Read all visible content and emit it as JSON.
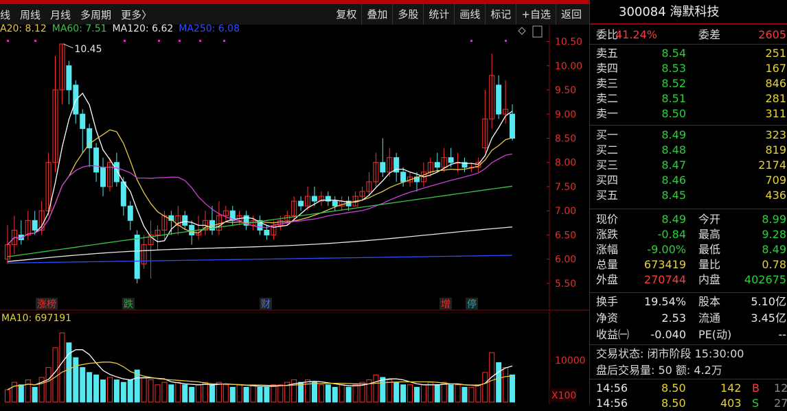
{
  "toolbar": {
    "left": [
      "线",
      "周线",
      "月线",
      "多周期",
      "更多〉"
    ],
    "right": [
      "复权",
      "叠加",
      "多股",
      "统计",
      "画线",
      "标记",
      "+自选",
      "返回"
    ]
  },
  "ma_legend": [
    {
      "label": "A20: 8.12",
      "color": "#e6c84a"
    },
    {
      "label": "MA60: 7.51",
      "color": "#37c74a"
    },
    {
      "label": "MA120: 6.62",
      "color": "#e8e8e8"
    },
    {
      "label": "MA250: 6.08",
      "color": "#2f4bff"
    }
  ],
  "chart_data": {
    "type": "candlestick",
    "y_ticks": [
      "10.50",
      "10.00",
      "9.50",
      "9.00",
      "8.50",
      "8.00",
      "7.50",
      "7.00",
      "6.50",
      "6.00",
      "5.50"
    ],
    "ylim": [
      5.4,
      10.55
    ],
    "high_marker": "10.45",
    "events": [
      {
        "label": "涨榜",
        "color": "#e03030"
      },
      {
        "label": "跌",
        "color": "#23b23a"
      },
      {
        "label": "财",
        "color": "#3a78ff"
      },
      {
        "label": "增",
        "color": "#e03030"
      },
      {
        "label": "停",
        "color": "#2aa3b0"
      }
    ],
    "volume_legend": "MA10: 697191",
    "volume_tick": "10000",
    "volume_unit": "X100",
    "candles": [
      [
        6.0,
        6.3,
        6.7,
        5.9
      ],
      [
        6.3,
        6.6,
        6.9,
        6.1
      ],
      [
        6.5,
        6.4,
        6.8,
        6.3
      ],
      [
        6.5,
        6.8,
        7.0,
        6.4
      ],
      [
        6.8,
        6.6,
        7.0,
        6.5
      ],
      [
        6.6,
        7.0,
        7.2,
        6.5
      ],
      [
        7.0,
        8.0,
        8.2,
        6.9
      ],
      [
        8.0,
        9.5,
        10.2,
        7.8
      ],
      [
        9.5,
        10.45,
        10.45,
        9.2
      ],
      [
        10.0,
        9.5,
        10.1,
        9.2
      ],
      [
        9.6,
        9.0,
        9.7,
        8.8
      ],
      [
        9.0,
        8.7,
        9.1,
        8.2
      ],
      [
        8.7,
        8.3,
        8.8,
        7.9
      ],
      [
        8.3,
        7.8,
        8.4,
        7.6
      ],
      [
        7.9,
        7.5,
        8.1,
        7.3
      ],
      [
        7.5,
        8.0,
        8.1,
        7.4
      ],
      [
        8.0,
        7.6,
        8.2,
        7.5
      ],
      [
        7.6,
        7.1,
        7.7,
        6.9
      ],
      [
        7.1,
        6.8,
        7.2,
        6.6
      ],
      [
        6.5,
        5.6,
        6.6,
        5.5
      ],
      [
        5.9,
        6.3,
        6.5,
        5.8
      ],
      [
        6.3,
        6.5,
        6.8,
        5.6
      ],
      [
        6.5,
        6.6,
        6.7,
        6.2
      ],
      [
        6.6,
        6.9,
        7.0,
        6.4
      ],
      [
        6.9,
        6.8,
        7.0,
        6.5
      ],
      [
        6.7,
        6.9,
        7.1,
        6.5
      ],
      [
        6.9,
        6.7,
        7.0,
        6.6
      ],
      [
        6.7,
        6.5,
        6.8,
        6.3
      ],
      [
        6.5,
        6.6,
        6.9,
        6.4
      ],
      [
        6.6,
        6.8,
        7.0,
        6.5
      ],
      [
        6.8,
        6.6,
        7.1,
        6.5
      ],
      [
        6.6,
        6.9,
        7.2,
        6.5
      ],
      [
        6.9,
        7.0,
        7.1,
        6.8
      ],
      [
        7.0,
        6.8,
        7.1,
        6.7
      ],
      [
        6.8,
        6.9,
        7.0,
        6.7
      ],
      [
        6.9,
        6.7,
        7.0,
        6.6
      ],
      [
        6.7,
        6.8,
        6.9,
        6.6
      ],
      [
        6.8,
        6.6,
        6.9,
        6.5
      ],
      [
        6.6,
        6.5,
        6.7,
        6.4
      ],
      [
        6.5,
        6.7,
        6.8,
        6.4
      ],
      [
        6.7,
        6.8,
        6.9,
        6.6
      ],
      [
        6.8,
        6.9,
        7.0,
        6.7
      ],
      [
        6.9,
        7.2,
        7.3,
        6.8
      ],
      [
        7.2,
        7.1,
        7.3,
        7.0
      ],
      [
        7.1,
        7.3,
        7.5,
        7.0
      ],
      [
        7.3,
        7.2,
        7.5,
        7.1
      ],
      [
        7.2,
        7.3,
        7.4,
        7.1
      ],
      [
        7.3,
        7.2,
        7.4,
        7.1
      ],
      [
        7.2,
        7.1,
        7.3,
        7.0
      ],
      [
        7.1,
        7.2,
        7.3,
        7.0
      ],
      [
        7.2,
        7.1,
        7.3,
        7.0
      ],
      [
        7.1,
        7.3,
        7.4,
        7.1
      ],
      [
        7.3,
        7.4,
        7.5,
        7.2
      ],
      [
        7.4,
        7.6,
        7.8,
        7.3
      ],
      [
        7.6,
        8.0,
        8.2,
        7.5
      ],
      [
        8.0,
        7.8,
        8.5,
        7.7
      ],
      [
        7.8,
        8.1,
        8.3,
        7.7
      ],
      [
        8.1,
        7.8,
        8.2,
        7.6
      ],
      [
        7.8,
        7.6,
        7.9,
        7.5
      ],
      [
        7.6,
        7.7,
        7.8,
        7.5
      ],
      [
        7.7,
        7.6,
        7.8,
        7.4
      ],
      [
        7.6,
        7.8,
        8.0,
        7.5
      ],
      [
        7.8,
        8.0,
        8.1,
        7.7
      ],
      [
        8.0,
        7.9,
        8.2,
        7.8
      ],
      [
        7.9,
        8.1,
        8.3,
        7.8
      ],
      [
        8.1,
        8.0,
        8.3,
        7.9
      ],
      [
        8.0,
        8.0,
        8.2,
        7.8
      ],
      [
        8.0,
        7.9,
        8.1,
        7.8
      ],
      [
        7.9,
        7.9,
        8.0,
        7.8
      ],
      [
        7.9,
        8.0,
        8.1,
        7.8
      ],
      [
        8.3,
        8.9,
        9.5,
        8.2
      ],
      [
        8.9,
        9.8,
        10.25,
        8.7
      ],
      [
        9.6,
        9.0,
        9.8,
        8.9
      ],
      [
        9.0,
        9.1,
        9.7,
        8.8
      ],
      [
        9.0,
        8.5,
        9.2,
        8.45
      ]
    ],
    "volumes": [
      5,
      8,
      7,
      9,
      6,
      10,
      14,
      22,
      28,
      24,
      18,
      14,
      12,
      11,
      9,
      10,
      9,
      8,
      9,
      13,
      10,
      9,
      7,
      8,
      7,
      8,
      7,
      6,
      7,
      8,
      7,
      8,
      7,
      6,
      7,
      6,
      7,
      6,
      6,
      7,
      7,
      8,
      9,
      8,
      9,
      8,
      7,
      7,
      6,
      7,
      6,
      7,
      8,
      9,
      11,
      10,
      9,
      8,
      7,
      7,
      6,
      7,
      8,
      7,
      8,
      7,
      7,
      6,
      6,
      7,
      12,
      20,
      16,
      14,
      11
    ]
  },
  "stock": {
    "title": "300084 海默科技",
    "weibi_label": "委比",
    "weibi": "41.24%",
    "weicha_label": "委差",
    "weicha": "2605",
    "asks": [
      {
        "label": "卖五",
        "price": "8.54",
        "vol": "251"
      },
      {
        "label": "卖四",
        "price": "8.53",
        "vol": "167"
      },
      {
        "label": "卖三",
        "price": "8.52",
        "vol": "846"
      },
      {
        "label": "卖二",
        "price": "8.51",
        "vol": "281"
      },
      {
        "label": "卖一",
        "price": "8.50",
        "vol": "311"
      }
    ],
    "bids": [
      {
        "label": "买一",
        "price": "8.49",
        "vol": "323"
      },
      {
        "label": "买二",
        "price": "8.48",
        "vol": "819"
      },
      {
        "label": "买三",
        "price": "8.47",
        "vol": "2174"
      },
      {
        "label": "买四",
        "price": "8.46",
        "vol": "709"
      },
      {
        "label": "买五",
        "price": "8.45",
        "vol": "436"
      }
    ],
    "stats": [
      {
        "l1": "现价",
        "v1": "8.49",
        "c1": "green",
        "l2": "今开",
        "v2": "8.99",
        "c2": "green"
      },
      {
        "l1": "涨跌",
        "v1": "-0.84",
        "c1": "green",
        "l2": "最高",
        "v2": "9.28",
        "c2": "green"
      },
      {
        "l1": "涨幅",
        "v1": "-9.00%",
        "c1": "green",
        "l2": "最低",
        "v2": "8.49",
        "c2": "green"
      },
      {
        "l1": "总量",
        "v1": "673419",
        "c1": "yel",
        "l2": "量比",
        "v2": "0.78",
        "c2": "yel"
      },
      {
        "l1": "外盘",
        "v1": "270744",
        "c1": "red",
        "l2": "内盘",
        "v2": "402675",
        "c2": "green"
      }
    ],
    "stats2": [
      {
        "l1": "换手",
        "v1": "19.54%",
        "l2": "股本",
        "v2": "5.10亿"
      },
      {
        "l1": "净资",
        "v1": "2.53",
        "l2": "流通",
        "v2": "3.45亿"
      },
      {
        "l1": "收益㈠",
        "v1": "-0.040",
        "l2": "PE(动)",
        "v2": "--"
      }
    ],
    "trade_status": "交易状态: 闭市阶段 15:30:00",
    "after_hours": "盘后交易量: 50  额: 4.2万",
    "ticks": [
      {
        "time": "14:56",
        "price": "8.50",
        "vol": "142",
        "dir": "B",
        "n": "12"
      },
      {
        "time": "14:56",
        "price": "8.50",
        "vol": "403",
        "dir": "S",
        "n": "27"
      }
    ]
  }
}
